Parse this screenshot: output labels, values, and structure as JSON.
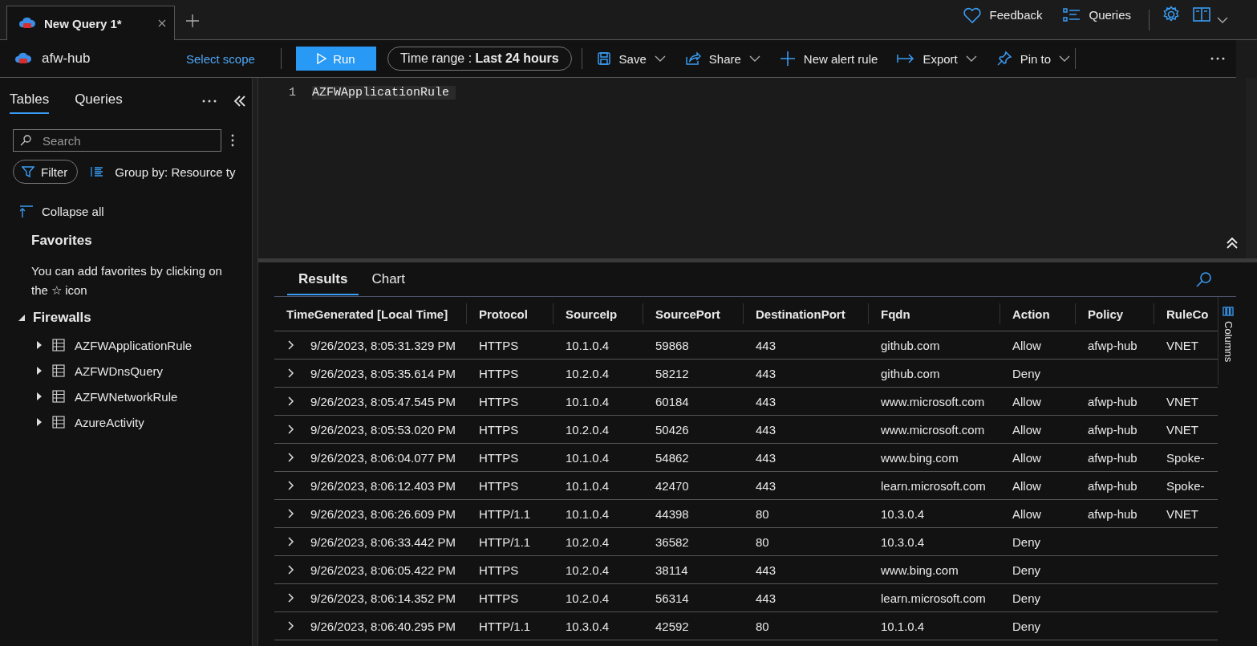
{
  "tabs": [
    {
      "title": "New Query 1*",
      "selected": true
    }
  ],
  "toolbar": {
    "workspace": "afw-hub",
    "scope_link": "Select scope",
    "run": "Run",
    "time_range_label": "Time range :",
    "time_range_value": "Last 24 hours",
    "actions": [
      {
        "kind": "save",
        "label": "Save",
        "dropdown": true
      },
      {
        "kind": "share",
        "label": "Share",
        "dropdown": true
      },
      {
        "kind": "alert",
        "label": "New alert rule",
        "dropdown": false
      },
      {
        "kind": "export",
        "label": "Export",
        "dropdown": true
      },
      {
        "kind": "pin",
        "label": "Pin to",
        "dropdown": true
      }
    ]
  },
  "top_right": {
    "feedback": "Feedback",
    "queries": "Queries"
  },
  "sidebar": {
    "tabs": [
      {
        "label": "Tables",
        "selected": true
      },
      {
        "label": "Queries",
        "selected": false
      }
    ],
    "search": {
      "placeholder": "Search"
    },
    "filter": "Filter",
    "group_by": "Group by: Resource ty",
    "collapse_all": "Collapse all",
    "favorites_title": "Favorites",
    "favorites_hint": "You can add favorites by clicking on the ☆ icon",
    "tree": [
      {
        "label": "Firewalls",
        "expanded": true,
        "children": [
          {
            "label": "AZFWApplicationRule",
            "expanded": false
          },
          {
            "label": "AZFWDnsQuery",
            "expanded": false
          },
          {
            "label": "AZFWNetworkRule",
            "expanded": false
          },
          {
            "label": "AzureActivity",
            "expanded": false
          }
        ]
      }
    ]
  },
  "editor": {
    "line_number": "1",
    "code": "AZFWApplicationRule"
  },
  "results": {
    "tabs": [
      {
        "label": "Results",
        "selected": true
      },
      {
        "label": "Chart",
        "selected": false
      }
    ],
    "columns_panel": "Columns",
    "columns": [
      "TimeGenerated [Local Time]",
      "Protocol",
      "SourceIp",
      "SourcePort",
      "DestinationPort",
      "Fqdn",
      "Action",
      "Policy",
      "RuleCo"
    ],
    "rows": [
      [
        "9/26/2023, 8:05:31.329 PM",
        "HTTPS",
        "10.1.0.4",
        "59868",
        "443",
        "github.com",
        "Allow",
        "afwp-hub",
        "VNET"
      ],
      [
        "9/26/2023, 8:05:35.614 PM",
        "HTTPS",
        "10.2.0.4",
        "58212",
        "443",
        "github.com",
        "Deny",
        "",
        ""
      ],
      [
        "9/26/2023, 8:05:47.545 PM",
        "HTTPS",
        "10.1.0.4",
        "60184",
        "443",
        "www.microsoft.com",
        "Allow",
        "afwp-hub",
        "VNET"
      ],
      [
        "9/26/2023, 8:05:53.020 PM",
        "HTTPS",
        "10.2.0.4",
        "50426",
        "443",
        "www.microsoft.com",
        "Allow",
        "afwp-hub",
        "VNET"
      ],
      [
        "9/26/2023, 8:06:04.077 PM",
        "HTTPS",
        "10.1.0.4",
        "54862",
        "443",
        "www.bing.com",
        "Allow",
        "afwp-hub",
        "Spoke-"
      ],
      [
        "9/26/2023, 8:06:12.403 PM",
        "HTTPS",
        "10.1.0.4",
        "42470",
        "443",
        "learn.microsoft.com",
        "Allow",
        "afwp-hub",
        "Spoke-"
      ],
      [
        "9/26/2023, 8:06:26.609 PM",
        "HTTP/1.1",
        "10.1.0.4",
        "44398",
        "80",
        "10.3.0.4",
        "Allow",
        "afwp-hub",
        "VNET"
      ],
      [
        "9/26/2023, 8:06:33.442 PM",
        "HTTP/1.1",
        "10.2.0.4",
        "36582",
        "80",
        "10.3.0.4",
        "Deny",
        "",
        ""
      ],
      [
        "9/26/2023, 8:06:05.422 PM",
        "HTTPS",
        "10.2.0.4",
        "38114",
        "443",
        "www.bing.com",
        "Deny",
        "",
        ""
      ],
      [
        "9/26/2023, 8:06:14.352 PM",
        "HTTPS",
        "10.2.0.4",
        "56314",
        "443",
        "learn.microsoft.com",
        "Deny",
        "",
        ""
      ],
      [
        "9/26/2023, 8:06:40.295 PM",
        "HTTP/1.1",
        "10.3.0.4",
        "42592",
        "80",
        "10.1.0.4",
        "Deny",
        "",
        ""
      ]
    ]
  }
}
